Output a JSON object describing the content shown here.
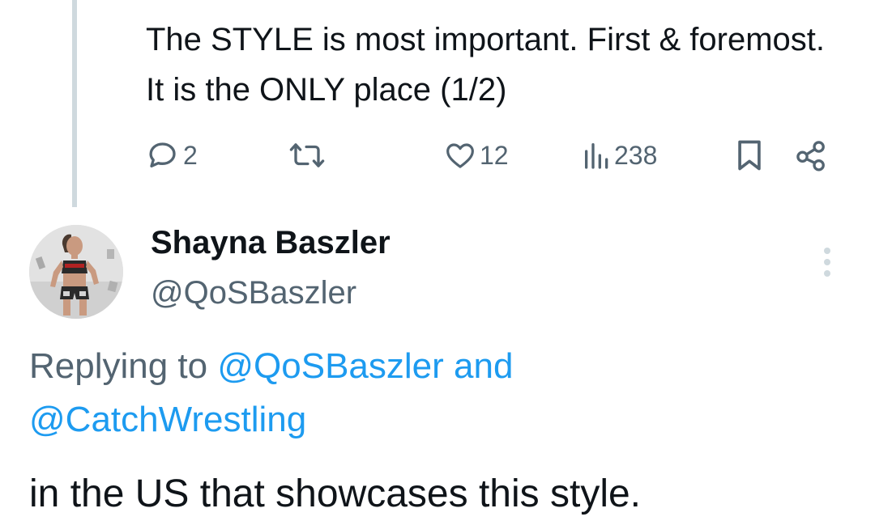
{
  "previous_tweet": {
    "text": "The STYLE is most important. First & foremost. It is the ONLY place (1/2)",
    "actions": {
      "replies": "2",
      "retweets": "",
      "likes": "12",
      "views": "238"
    }
  },
  "reply_tweet": {
    "author": {
      "name": "Shayna Baszler",
      "handle": "@QoSBaszler"
    },
    "replying_to": {
      "prefix": "Replying to",
      "mention1": "@QoSBaszler",
      "conjunction": "and",
      "mention2": "@CatchWrestling"
    },
    "text": "in the US that showcases this style."
  },
  "icons": {
    "reply": "speech-bubble-icon",
    "retweet": "retweet-icon",
    "like": "heart-icon",
    "views": "bar-chart-icon",
    "bookmark": "bookmark-icon",
    "share": "share-icon",
    "more": "vertical-ellipsis-icon"
  },
  "colors": {
    "text": "#0f1419",
    "secondary": "#536471",
    "link": "#1d9bf0",
    "thread_line": "#cfd9de"
  }
}
